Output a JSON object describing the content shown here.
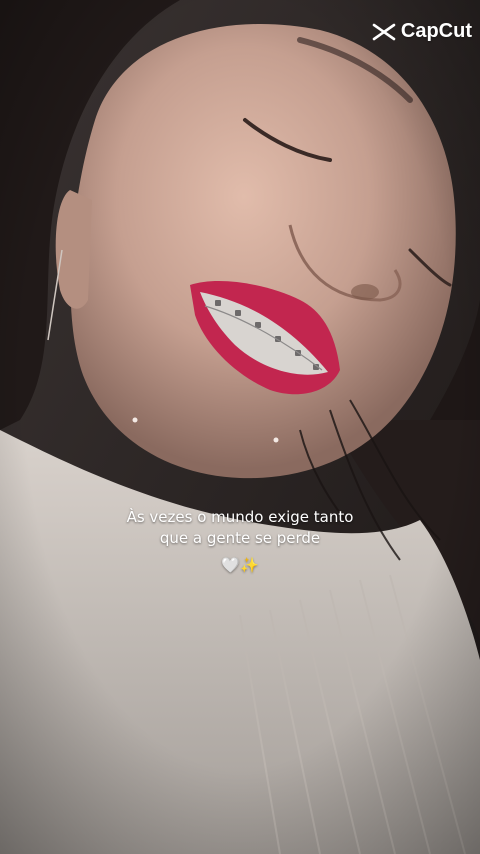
{
  "watermark": {
    "icon": "capcut-logo-icon",
    "label": "CapCut"
  },
  "caption": {
    "line1": "Às vezes o mundo exige tanto",
    "line2": "que a gente se perde",
    "emoji": "🤍✨"
  },
  "colors": {
    "lipstick": "#c2264f",
    "skin": "#c9a394",
    "sweater": "#d8d1cb",
    "hair": "#1e1716"
  }
}
